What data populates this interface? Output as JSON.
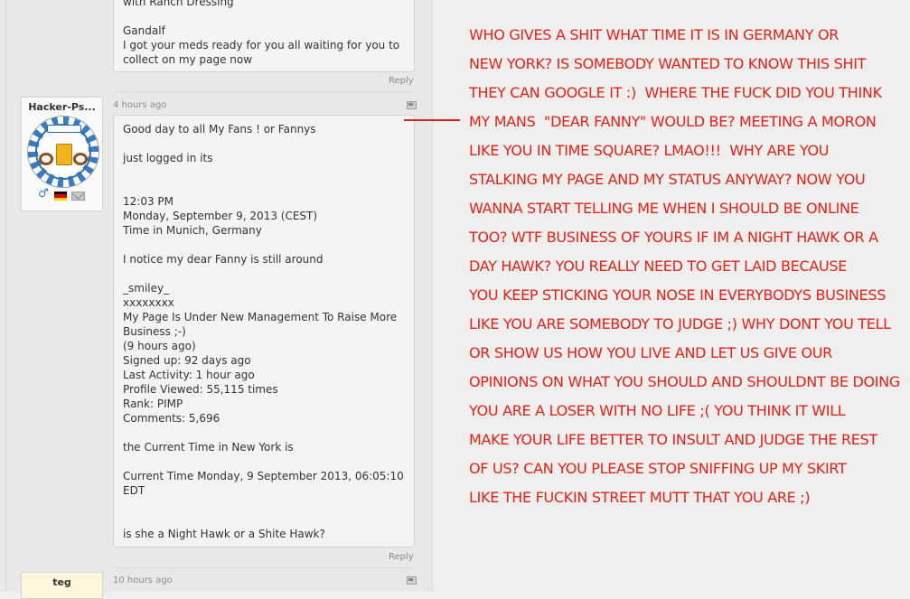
{
  "previous_comment": {
    "lines": [
      "with Ranch Dressing",
      "",
      "Gandalf",
      "I got your meds ready for you all waiting for you to",
      "collect on my page now"
    ],
    "reply_label": "Reply"
  },
  "comment": {
    "username": "Hacker-Ps...",
    "time_ago": "4 hours ago",
    "lines": [
      "Good day to all My Fans ! or Fannys",
      "",
      "just logged in its",
      "",
      "",
      "12:03 PM",
      "Monday, September 9, 2013 (CEST)",
      "Time in Munich, Germany",
      "",
      "I notice my dear Fanny is still around",
      "",
      "_smiley_",
      "xxxxxxxx",
      "My Page Is Under New Management To Raise More",
      "Business ;-)",
      "(9 hours ago)",
      "Signed up: 92 days ago",
      "Last Activity: 1 hour ago",
      "Profile Viewed: 55,115 times",
      "Rank: PIMP",
      "Comments: 5,696",
      "",
      "the Current Time in New York is",
      "",
      "Current Time Monday, 9 September 2013, 06:05:10",
      "EDT",
      "",
      "",
      "is she a Night Hawk or a Shite Hawk?"
    ],
    "reply_label": "Reply",
    "avatar_banner": "Oktoberfest"
  },
  "next_comment": {
    "username": "teg",
    "time_ago": "10 hours ago"
  },
  "annotation": {
    "color": "#e8201a",
    "lines": [
      "WHO GIVES A SHIT WHAT TIME IT IS IN GERMANY OR",
      "NEW YORK? IS SOMEBODY WANTED TO KNOW THIS SHIT",
      "THEY CAN GOOGLE IT :)  WHERE THE FUCK DID YOU THINK",
      "MY MANS  \"DEAR FANNY\" WOULD BE? MEETING A MORON",
      "LIKE YOU IN TIME SQUARE? LMAO!!!  WHY ARE YOU",
      "STALKING MY PAGE AND MY STATUS ANYWAY? NOW YOU",
      "WANNA START TELLING ME WHEN I SHOULD BE ONLINE",
      "TOO? WTF BUSINESS OF YOURS IF IM A NIGHT HAWK OR A",
      "DAY HAWK? YOU REALLY NEED TO GET LAID BECAUSE",
      "YOU KEEP STICKING YOUR NOSE IN EVERYBODYS BUSINESS",
      "LIKE YOU ARE SOMEBODY TO JUDGE ;) WHY DONT YOU TELL",
      "OR SHOW US HOW YOU LIVE AND LET US GIVE OUR",
      "OPINIONS ON WHAT YOU SHOULD AND SHOULDNT BE DOING",
      "YOU ARE A LOSER WITH NO LIFE ;( YOU THINK IT WILL",
      "MAKE YOUR LIFE BETTER TO INSULT AND JUDGE THE REST",
      "OF US? CAN YOU PLEASE STOP SNIFFING UP MY SKIRT",
      "LIKE THE FUCKIN STREET MUTT THAT YOU ARE ;)"
    ]
  },
  "icons": {
    "gender": "male-icon",
    "country": "flag-germany-icon",
    "message": "mail-icon",
    "report": "report-flag-icon"
  }
}
